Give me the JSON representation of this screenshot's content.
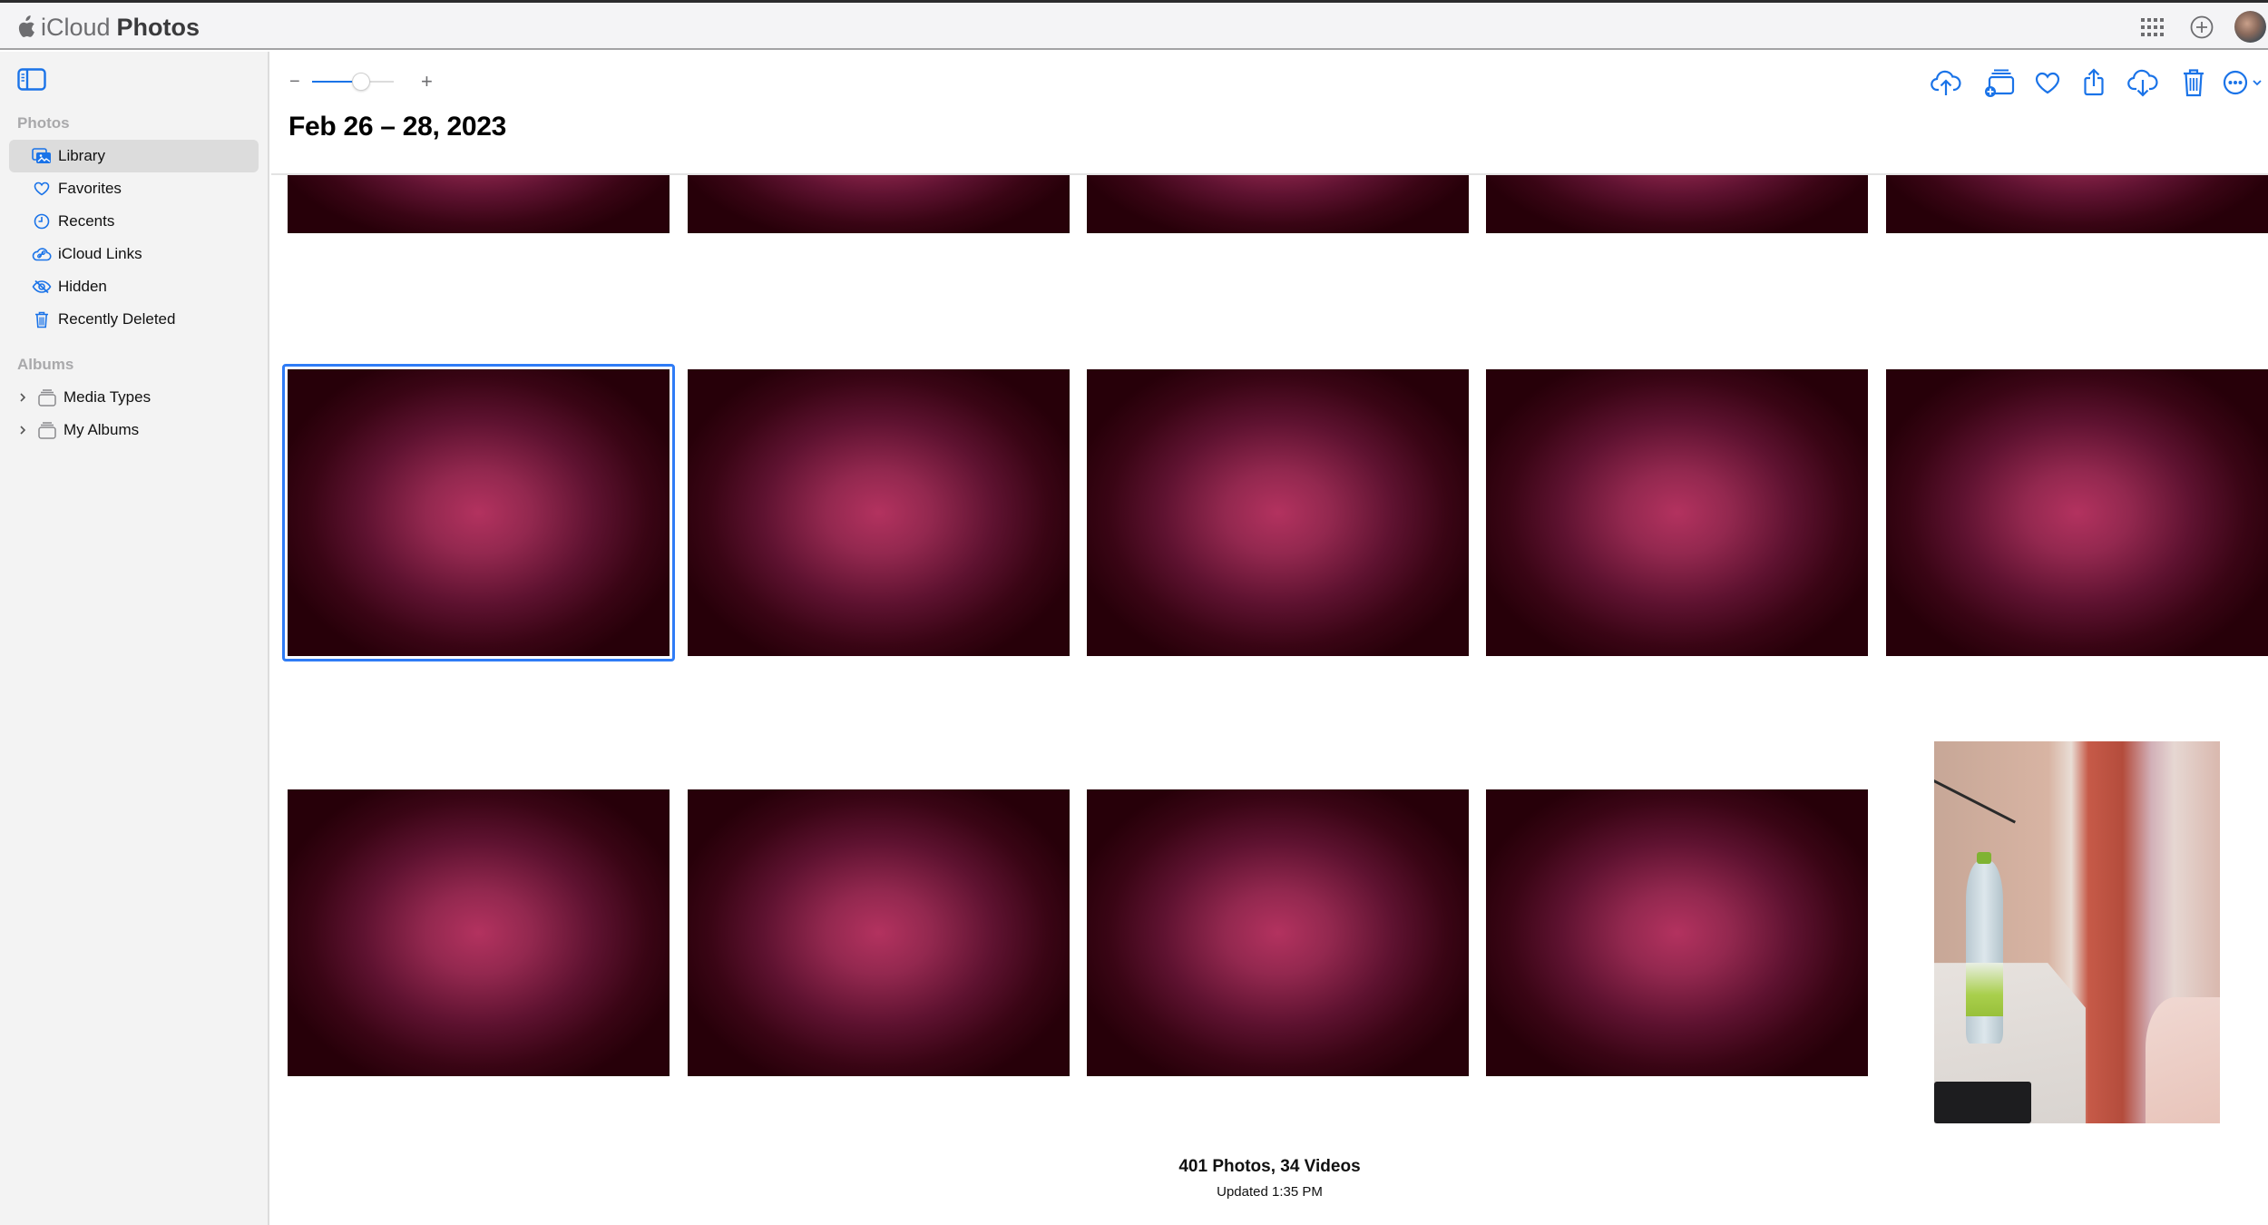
{
  "app": {
    "brand_prefix": "iCloud",
    "brand_name": "Photos"
  },
  "header": {
    "icons": [
      "apps-grid-icon",
      "add-circle-icon",
      "account-avatar"
    ]
  },
  "sidebar": {
    "sections": [
      {
        "title": "Photos",
        "items": [
          {
            "label": "Library",
            "icon": "library-icon",
            "selected": true
          },
          {
            "label": "Favorites",
            "icon": "heart-icon",
            "selected": false
          },
          {
            "label": "Recents",
            "icon": "clock-icon",
            "selected": false
          },
          {
            "label": "iCloud Links",
            "icon": "cloud-link-icon",
            "selected": false
          },
          {
            "label": "Hidden",
            "icon": "eye-slash-icon",
            "selected": false
          },
          {
            "label": "Recently Deleted",
            "icon": "trash-icon",
            "selected": false
          }
        ]
      },
      {
        "title": "Albums",
        "items": [
          {
            "label": "Media Types",
            "icon": "album-stack-icon",
            "expandable": true
          },
          {
            "label": "My Albums",
            "icon": "album-stack-icon",
            "expandable": true
          }
        ]
      }
    ]
  },
  "toolbar": {
    "zoom_minus": "−",
    "zoom_plus": "+",
    "zoom_level": 0.6,
    "actions": [
      "upload-icon",
      "add-to-album-icon",
      "favorite-icon",
      "share-icon",
      "download-icon",
      "delete-icon",
      "more-icon"
    ]
  },
  "main": {
    "date_title": "Feb 26 – 28, 2023",
    "photos": [
      {
        "row": 0,
        "col": 0,
        "kind": "pink-gradient"
      },
      {
        "row": 0,
        "col": 1,
        "kind": "pink-gradient"
      },
      {
        "row": 0,
        "col": 2,
        "kind": "pink-gradient"
      },
      {
        "row": 0,
        "col": 3,
        "kind": "pink-gradient"
      },
      {
        "row": 0,
        "col": 4,
        "kind": "pink-gradient"
      },
      {
        "row": 1,
        "col": 0,
        "kind": "pink-gradient",
        "selected": true
      },
      {
        "row": 1,
        "col": 1,
        "kind": "pink-gradient"
      },
      {
        "row": 1,
        "col": 2,
        "kind": "pink-gradient"
      },
      {
        "row": 1,
        "col": 3,
        "kind": "pink-gradient"
      },
      {
        "row": 1,
        "col": 4,
        "kind": "pink-gradient"
      },
      {
        "row": 2,
        "col": 0,
        "kind": "pink-gradient"
      },
      {
        "row": 2,
        "col": 1,
        "kind": "pink-gradient"
      },
      {
        "row": 2,
        "col": 2,
        "kind": "pink-gradient"
      },
      {
        "row": 2,
        "col": 3,
        "kind": "pink-gradient"
      },
      {
        "row": 2,
        "col": 4,
        "kind": "room-photo-water-bottle"
      }
    ],
    "footer": {
      "count": "401 Photos, 34 Videos",
      "updated": "Updated 1:35 PM"
    }
  },
  "colors": {
    "accent": "#1a73e8",
    "selection": "#2f7cf6",
    "sidebar_bg": "#f3f3f3",
    "header_bg": "#f4f4f6"
  }
}
